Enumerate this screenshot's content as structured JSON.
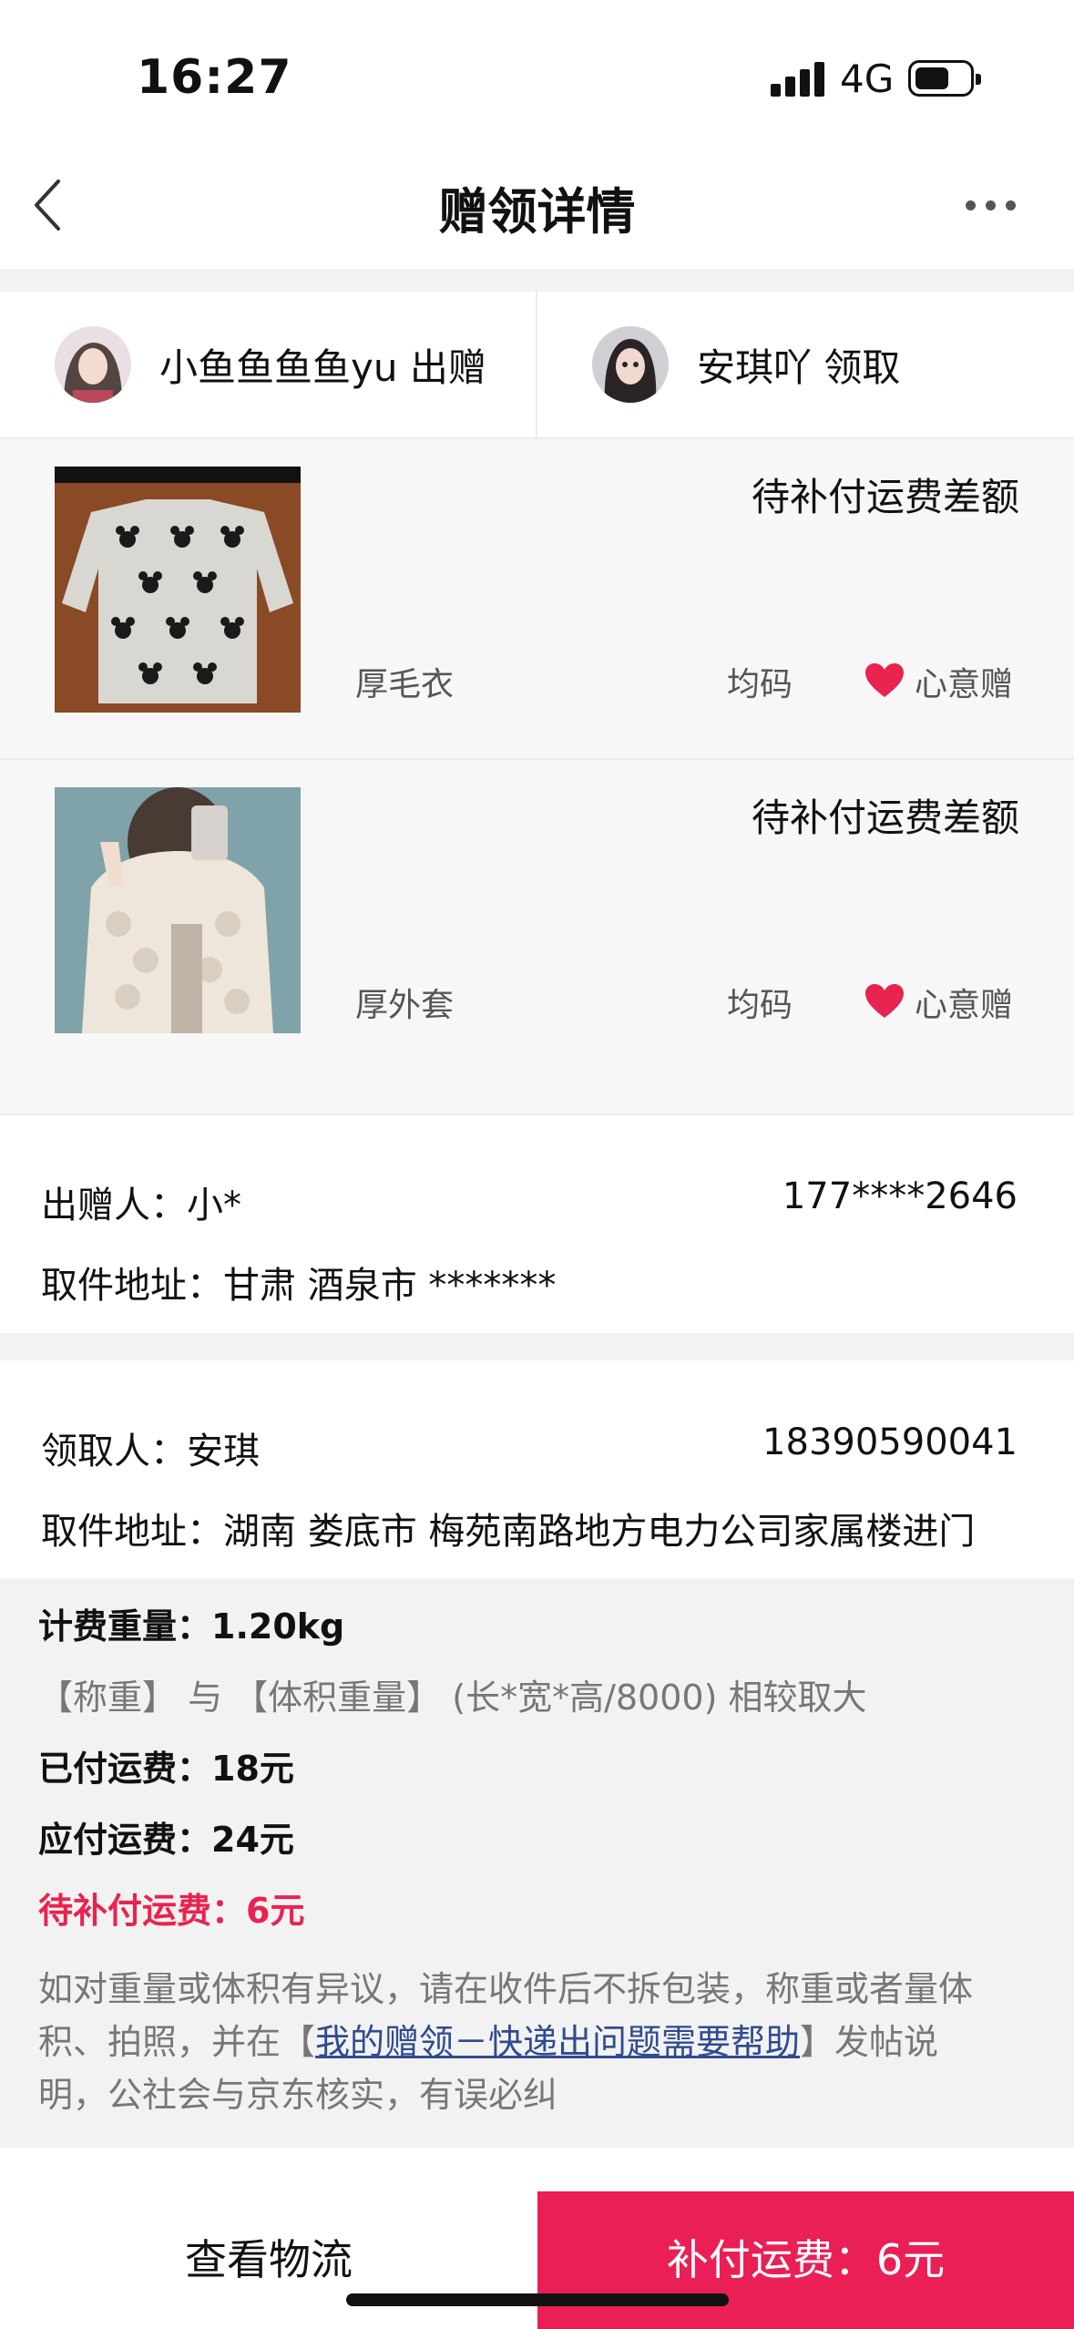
{
  "status_bar": {
    "time": "16:27",
    "network": "4G"
  },
  "nav": {
    "title": "赠领详情",
    "back_icon": "chevron-left-icon",
    "more_icon": "more-dots-icon"
  },
  "participants": {
    "giver": {
      "name": "小鱼鱼鱼鱼yu 出赠"
    },
    "receiver": {
      "name": "安琪吖 领取"
    }
  },
  "items": [
    {
      "status": "待补付运费差额",
      "name": "厚毛衣",
      "size": "均码",
      "tag": "心意赠"
    },
    {
      "status": "待补付运费差额",
      "name": "厚外套",
      "size": "均码",
      "tag": "心意赠"
    }
  ],
  "sender": {
    "label": "出赠人：小*",
    "phone": "177****2646",
    "address": "取件地址：甘肃 酒泉市 *******"
  },
  "receiver": {
    "label": "领取人：安琪",
    "phone": "18390590041",
    "address": "取件地址：湖南 娄底市 梅苑南路地方电力公司家属楼进门"
  },
  "fees": {
    "weight_label": "计费重量：",
    "weight_value": "1.20kg",
    "weight_note": "【称重】 与 【体积重量】 (长*宽*高/8000) 相较取大",
    "paid_label": "已付运费：",
    "paid_value": "18元",
    "due_label": "应付运费：",
    "due_value": "24元",
    "pending_label": "待补付运费：",
    "pending_value": "6元",
    "notice_1": "如对重量或体积有异议，请在收件后不拆包装，称重或者量体",
    "notice_2a": "积、拍照，并在【",
    "notice_link": "我的赠领－快递出问题需要帮助",
    "notice_2b": "】发帖说",
    "notice_3": "明，公社会与京东核实，有误必纠"
  },
  "bottom": {
    "logistics_label": "查看物流",
    "pay_label": "补付运费：6元"
  },
  "colors": {
    "accent": "#ea1f55",
    "pending_text": "#e8234f",
    "link": "#2f4c8f"
  }
}
